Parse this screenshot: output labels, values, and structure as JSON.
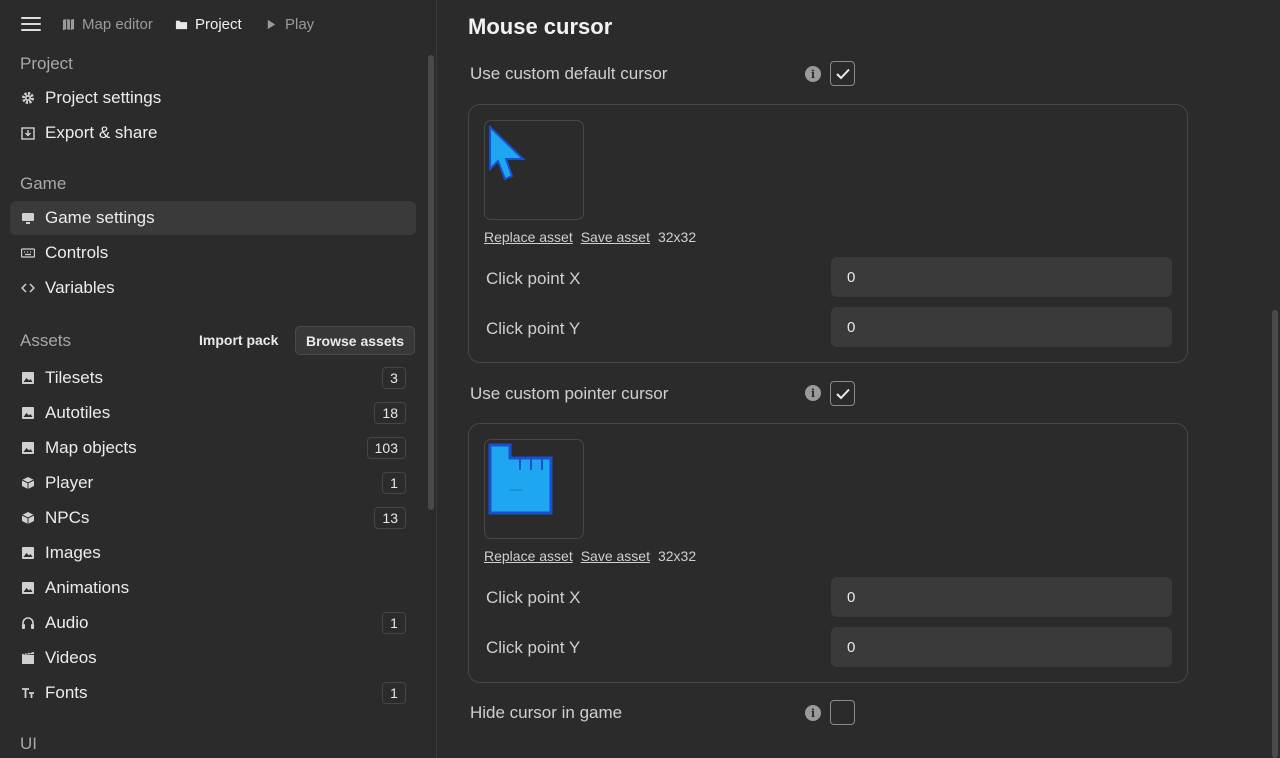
{
  "breadcrumbs": {
    "map_editor": "Map editor",
    "project": "Project",
    "play": "Play"
  },
  "sidebar": {
    "project_title": "Project",
    "project_items": [
      {
        "label": "Project settings",
        "icon": "gear-icon"
      },
      {
        "label": "Export & share",
        "icon": "export-icon"
      }
    ],
    "game_title": "Game",
    "game_items": [
      {
        "label": "Game settings",
        "icon": "monitor-icon",
        "selected": true
      },
      {
        "label": "Controls",
        "icon": "keyboard-icon"
      },
      {
        "label": "Variables",
        "icon": "code-icon"
      }
    ],
    "assets_title": "Assets",
    "import_pack": "Import pack",
    "browse_assets": "Browse assets",
    "asset_items": [
      {
        "label": "Tilesets",
        "icon": "image-icon",
        "count": "3"
      },
      {
        "label": "Autotiles",
        "icon": "image-icon",
        "count": "18"
      },
      {
        "label": "Map objects",
        "icon": "image-icon",
        "count": "103"
      },
      {
        "label": "Player",
        "icon": "cube-icon",
        "count": "1"
      },
      {
        "label": "NPCs",
        "icon": "cube-icon",
        "count": "13"
      },
      {
        "label": "Images",
        "icon": "image-icon",
        "count": ""
      },
      {
        "label": "Animations",
        "icon": "image-icon",
        "count": ""
      },
      {
        "label": "Audio",
        "icon": "headphones-icon",
        "count": "1"
      },
      {
        "label": "Videos",
        "icon": "film-icon",
        "count": ""
      },
      {
        "label": "Fonts",
        "icon": "font-icon",
        "count": "1"
      }
    ],
    "ui_title": "UI"
  },
  "main": {
    "heading": "Mouse cursor",
    "default_cursor": {
      "label": "Use custom default cursor",
      "checked": true,
      "replace": "Replace asset",
      "save": "Save asset",
      "size": "32x32",
      "click_x_label": "Click point X",
      "click_x_value": "0",
      "click_y_label": "Click point Y",
      "click_y_value": "0"
    },
    "pointer_cursor": {
      "label": "Use custom pointer cursor",
      "checked": true,
      "replace": "Replace asset",
      "save": "Save asset",
      "size": "32x32",
      "click_x_label": "Click point X",
      "click_x_value": "0",
      "click_y_label": "Click point Y",
      "click_y_value": "0"
    },
    "hide_cursor": {
      "label": "Hide cursor in game",
      "checked": false
    }
  },
  "colors": {
    "background": "#2b2b2b",
    "selected": "#3a3a3a",
    "cursor_fill": "#1ea7f0",
    "cursor_outline": "#1a4fd0"
  }
}
